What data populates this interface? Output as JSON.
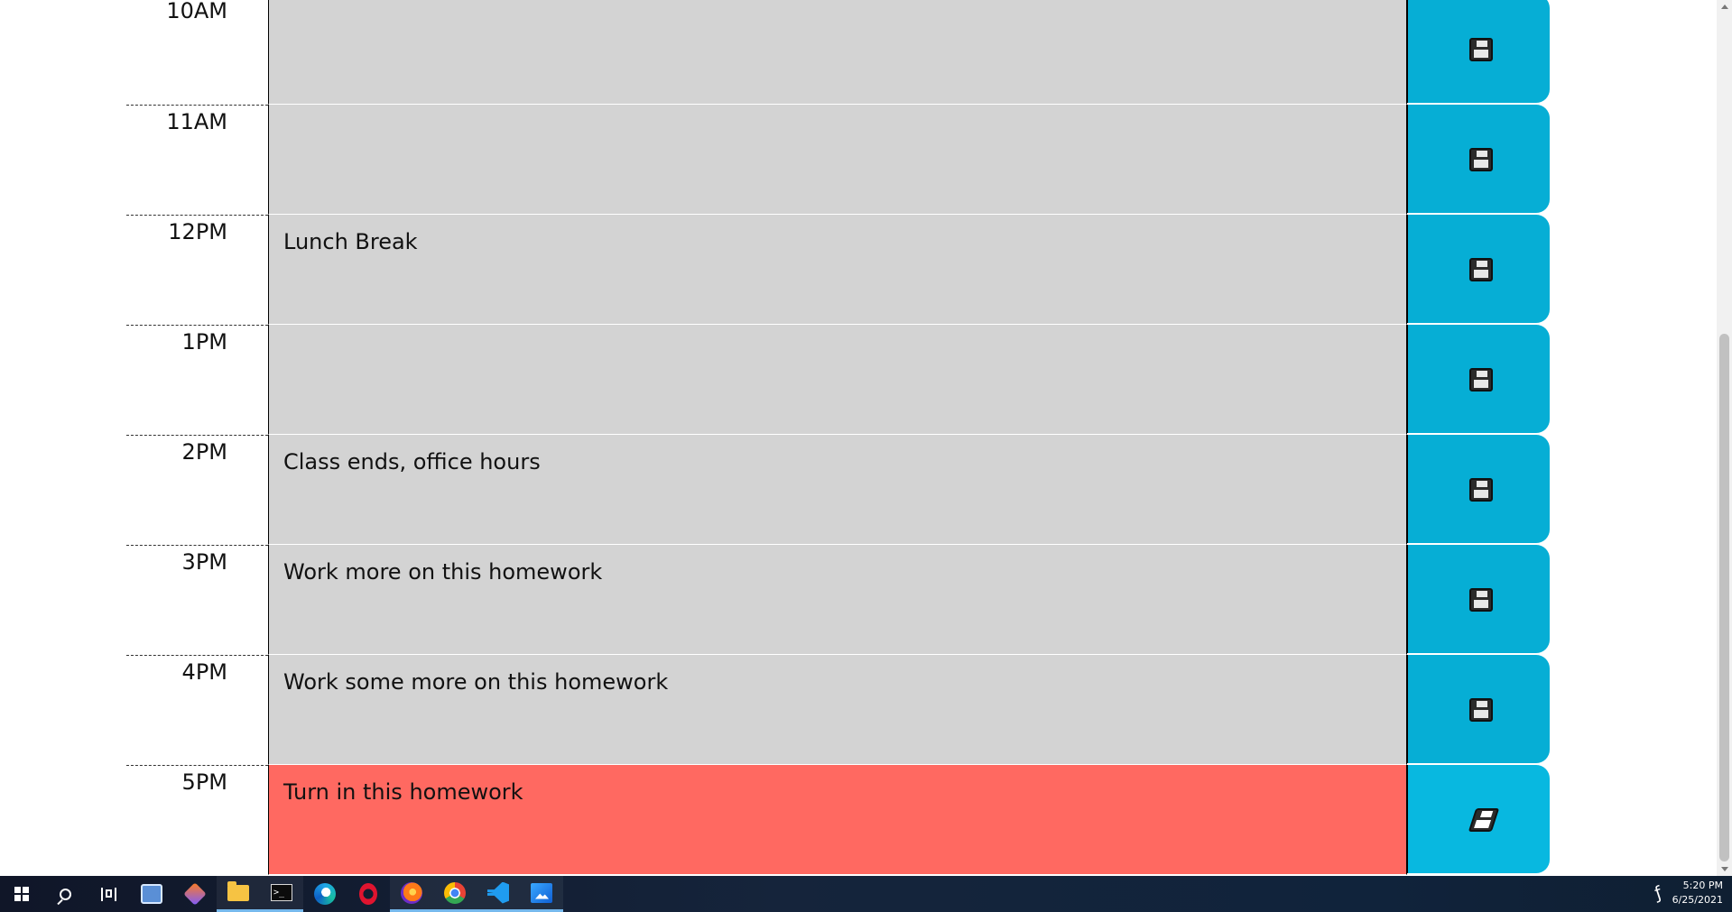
{
  "scheduler": {
    "rows": [
      {
        "time": "10AM",
        "description": "",
        "state": "past"
      },
      {
        "time": "11AM",
        "description": "",
        "state": "past"
      },
      {
        "time": "12PM",
        "description": "Lunch Break",
        "state": "past"
      },
      {
        "time": "1PM",
        "description": "",
        "state": "past"
      },
      {
        "time": "2PM",
        "description": "Class ends, office hours",
        "state": "past"
      },
      {
        "time": "3PM",
        "description": "Work more on this homework",
        "state": "past"
      },
      {
        "time": "4PM",
        "description": "Work some more on this homework",
        "state": "past"
      },
      {
        "time": "5PM",
        "description": "Turn in this homework",
        "state": "present"
      }
    ],
    "colors": {
      "past": "#d3d3d3",
      "present": "#ff6961",
      "save": "#06aed5"
    },
    "save_icon": "floppy-disk-icon"
  },
  "taskbar": {
    "icons": [
      "start-icon",
      "search-icon",
      "task-view-icon",
      "remote-desktop-icon",
      "git-icon",
      "file-explorer-icon",
      "terminal-icon",
      "edge-icon",
      "opera-icon",
      "firefox-icon",
      "chrome-icon",
      "vscode-icon",
      "photos-icon"
    ],
    "clock_time": "5:20 PM",
    "clock_date": "6/25/2021"
  }
}
